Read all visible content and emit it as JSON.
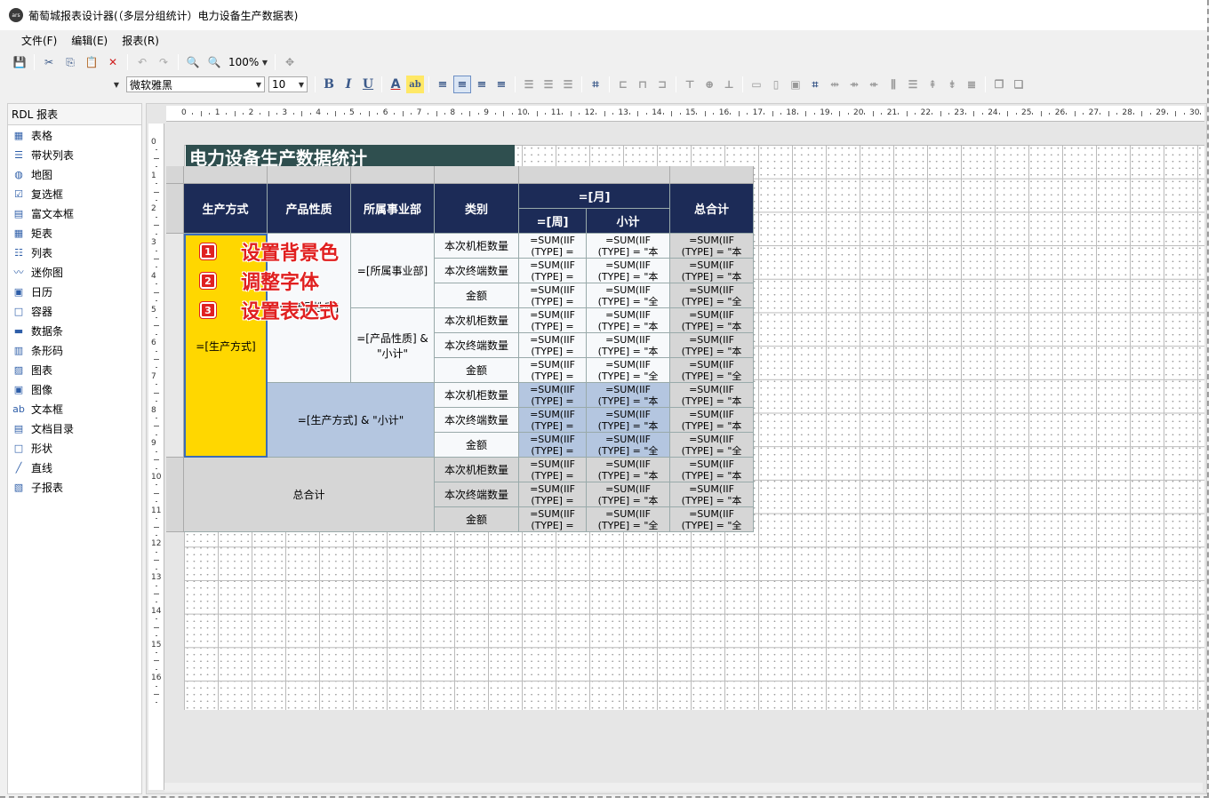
{
  "window": {
    "title": "葡萄城报表设计器(（多层分组统计）电力设备生产数据表)",
    "icon_label": "ars"
  },
  "menu": [
    "文件(F)",
    "编辑(E)",
    "报表(R)"
  ],
  "toolbar": {
    "zoom": "100%"
  },
  "format_bar": {
    "font_name": "微软雅黑",
    "font_size": "10"
  },
  "left_panel": {
    "header": "RDL 报表",
    "items": [
      {
        "label": "表格",
        "icon": "table-icon",
        "glyph": "▦"
      },
      {
        "label": "带状列表",
        "icon": "banded-list-icon",
        "glyph": "☰"
      },
      {
        "label": "地图",
        "icon": "globe-icon",
        "glyph": "◍"
      },
      {
        "label": "复选框",
        "icon": "checkbox-icon",
        "glyph": "☑"
      },
      {
        "label": "富文本框",
        "icon": "rich-text-icon",
        "glyph": "▤"
      },
      {
        "label": "矩表",
        "icon": "matrix-icon",
        "glyph": "▦"
      },
      {
        "label": "列表",
        "icon": "list-icon",
        "glyph": "☷"
      },
      {
        "label": "迷你图",
        "icon": "sparkline-icon",
        "glyph": "〰"
      },
      {
        "label": "日历",
        "icon": "calendar-icon",
        "glyph": "▣"
      },
      {
        "label": "容器",
        "icon": "container-icon",
        "glyph": "□"
      },
      {
        "label": "数据条",
        "icon": "databar-icon",
        "glyph": "▬"
      },
      {
        "label": "条形码",
        "icon": "barcode-icon",
        "glyph": "▥"
      },
      {
        "label": "图表",
        "icon": "chart-icon",
        "glyph": "▨"
      },
      {
        "label": "图像",
        "icon": "image-icon",
        "glyph": "▣"
      },
      {
        "label": "文本框",
        "icon": "textbox-icon",
        "glyph": "ab"
      },
      {
        "label": "文档目录",
        "icon": "toc-icon",
        "glyph": "▤"
      },
      {
        "label": "形状",
        "icon": "shape-icon",
        "glyph": "□"
      },
      {
        "label": "直线",
        "icon": "line-icon",
        "glyph": "╱"
      },
      {
        "label": "子报表",
        "icon": "subreport-icon",
        "glyph": "▧"
      }
    ]
  },
  "ruler": {
    "h": [
      "0",
      "1",
      "2",
      "3",
      "4",
      "5",
      "6",
      "7",
      "8",
      "9",
      "10",
      "11",
      "12",
      "13",
      "14",
      "15",
      "16",
      "17",
      "18",
      "19",
      "20",
      "21",
      "22",
      "23",
      "24",
      "25",
      "26",
      "27",
      "28",
      "29",
      "30"
    ],
    "v": [
      "0",
      "1",
      "2",
      "3",
      "4",
      "5",
      "6",
      "7",
      "8",
      "9",
      "10",
      "11",
      "12",
      "13",
      "14",
      "15",
      "16"
    ]
  },
  "report": {
    "title": "电力设备生产数据统计",
    "headers": {
      "col1": "生产方式",
      "col2": "产品性质",
      "col3": "所属事业部",
      "col4": "类别",
      "month": "=[月]",
      "week": "=[周]",
      "subtotal": "小计",
      "grand_total": "总合计"
    },
    "cells": {
      "production": "=[生产方式]",
      "product": "=[产品性质]",
      "division": "=[所属事业部]",
      "product_subtotal": "=[产品性质] &\n\"小计\"",
      "production_subtotal": "=[生产方式] & \"小计\"",
      "total": "总合计"
    },
    "categories": [
      "本次机柜数量",
      "本次终端数量",
      "金额",
      "本次机柜数量",
      "本次终端数量",
      "金额",
      "本次机柜数量",
      "本次终端数量",
      "金额",
      "本次机柜数量",
      "本次终端数量",
      "金额"
    ],
    "expr_line1": "=SUM(IIF",
    "expr_line1_b": "=SUM(IIF",
    "expr_line2_a": "(TYPE] =",
    "expr_line2_b": "(TYPE] = \"本",
    "expr_line2_c": "(TYPE] = \"全"
  },
  "annotations": [
    {
      "num": "1",
      "text": "设置背景色"
    },
    {
      "num": "2",
      "text": "调整字体"
    },
    {
      "num": "3",
      "text": "设置表达式"
    }
  ],
  "colors": {
    "header_bg": "#1c2b57",
    "title_bg": "#2f4f4f",
    "highlight": "#ffd700",
    "subtotal_bg": "#b4c6e0",
    "annotation": "#e02020"
  }
}
